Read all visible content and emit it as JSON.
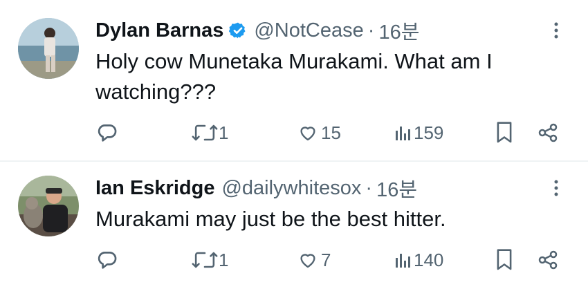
{
  "tweets": [
    {
      "author_name": "Dylan Barnas",
      "verified": true,
      "handle": "@NotCease",
      "separator": "·",
      "time": "16분",
      "text_line1": "Holy cow Munetaka Murakami. What am I",
      "text_line2": "watching???",
      "actions": {
        "reply_count": "",
        "retweet_count": "1",
        "like_count": "15",
        "view_count": "159"
      }
    },
    {
      "author_name": "Ian Eskridge",
      "verified": false,
      "handle": "@dailywhitesox",
      "separator": "·",
      "time": "16분",
      "text_line1": "Murakami may just be the best hitter.",
      "text_line2": "",
      "actions": {
        "reply_count": "",
        "retweet_count": "1",
        "like_count": "7",
        "view_count": "140"
      }
    }
  ],
  "icons": {
    "verified": "verified-badge-icon",
    "more": "more-vertical-icon",
    "reply": "reply-icon",
    "retweet": "retweet-icon",
    "like": "heart-icon",
    "views": "views-icon",
    "bookmark": "bookmark-icon",
    "share": "share-icon"
  },
  "colors": {
    "text": "#0f1419",
    "secondary": "#536471",
    "verified": "#1d9bf0",
    "divider": "#eff3f4"
  }
}
